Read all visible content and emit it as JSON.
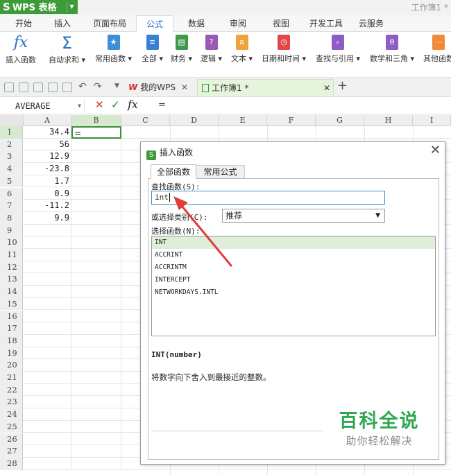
{
  "app": {
    "name": "WPS 表格",
    "window_title": "工作簿1 *"
  },
  "menu_tabs": [
    "开始",
    "插入",
    "页面布局",
    "公式",
    "数据",
    "审阅",
    "视图",
    "开发工具",
    "云服务"
  ],
  "active_menu": "公式",
  "ribbon": [
    {
      "label": "插入函数",
      "icon": "fx-icon"
    },
    {
      "label": "自动求和",
      "icon": "sigma-icon"
    },
    {
      "label": "常用函数",
      "icon": "star-icon"
    },
    {
      "label": "全部",
      "icon": "list-icon"
    },
    {
      "label": "财务",
      "icon": "finance-icon"
    },
    {
      "label": "逻辑",
      "icon": "question-icon"
    },
    {
      "label": "文本",
      "icon": "text-icon"
    },
    {
      "label": "日期和时间",
      "icon": "clock-icon"
    },
    {
      "label": "查找与引用",
      "icon": "lookup-icon"
    },
    {
      "label": "数学和三角",
      "icon": "theta-icon"
    },
    {
      "label": "其他函数",
      "icon": "more-icon"
    }
  ],
  "doc_tabs": {
    "wps": "我的WPS",
    "book": "工作簿1 *"
  },
  "formula_bar": {
    "name_box": "AVERAGE",
    "fx": "fx",
    "content": "="
  },
  "columns": [
    "A",
    "B",
    "C",
    "D",
    "E",
    "F",
    "G",
    "H",
    "I"
  ],
  "rows": [
    "1",
    "2",
    "3",
    "4",
    "5",
    "6",
    "7",
    "8",
    "9",
    "10",
    "11",
    "12",
    "13",
    "14",
    "15",
    "16",
    "17",
    "18",
    "19",
    "20",
    "21",
    "22",
    "23",
    "24",
    "25",
    "26",
    "27",
    "28"
  ],
  "col_a_values": [
    "34.4",
    "56",
    "12.9",
    "-23.8",
    "1.7",
    "0.9",
    "-11.2",
    "9.9"
  ],
  "cell_b1": "=",
  "dialog": {
    "title": "插入函数",
    "tabs": [
      "全部函数",
      "常用公式"
    ],
    "search_label": "查找函数(S):",
    "search_value": "int",
    "category_label": "或选择类别(C):",
    "category_value": "推荐",
    "select_label": "选择函数(N):",
    "functions": [
      "INT",
      "ACCRINT",
      "ACCRINTM",
      "INTERCEPT",
      "NETWORKDAYS.INTL"
    ],
    "signature": "INT(number)",
    "description": "将数字向下舍入到最接近的整数。"
  },
  "watermark": {
    "title": "百科全说",
    "subtitle": "助你轻松解决"
  },
  "colors": {
    "brand": "#3d9b39",
    "accent": "#1e6ccc",
    "arrow": "#e23b3b"
  }
}
